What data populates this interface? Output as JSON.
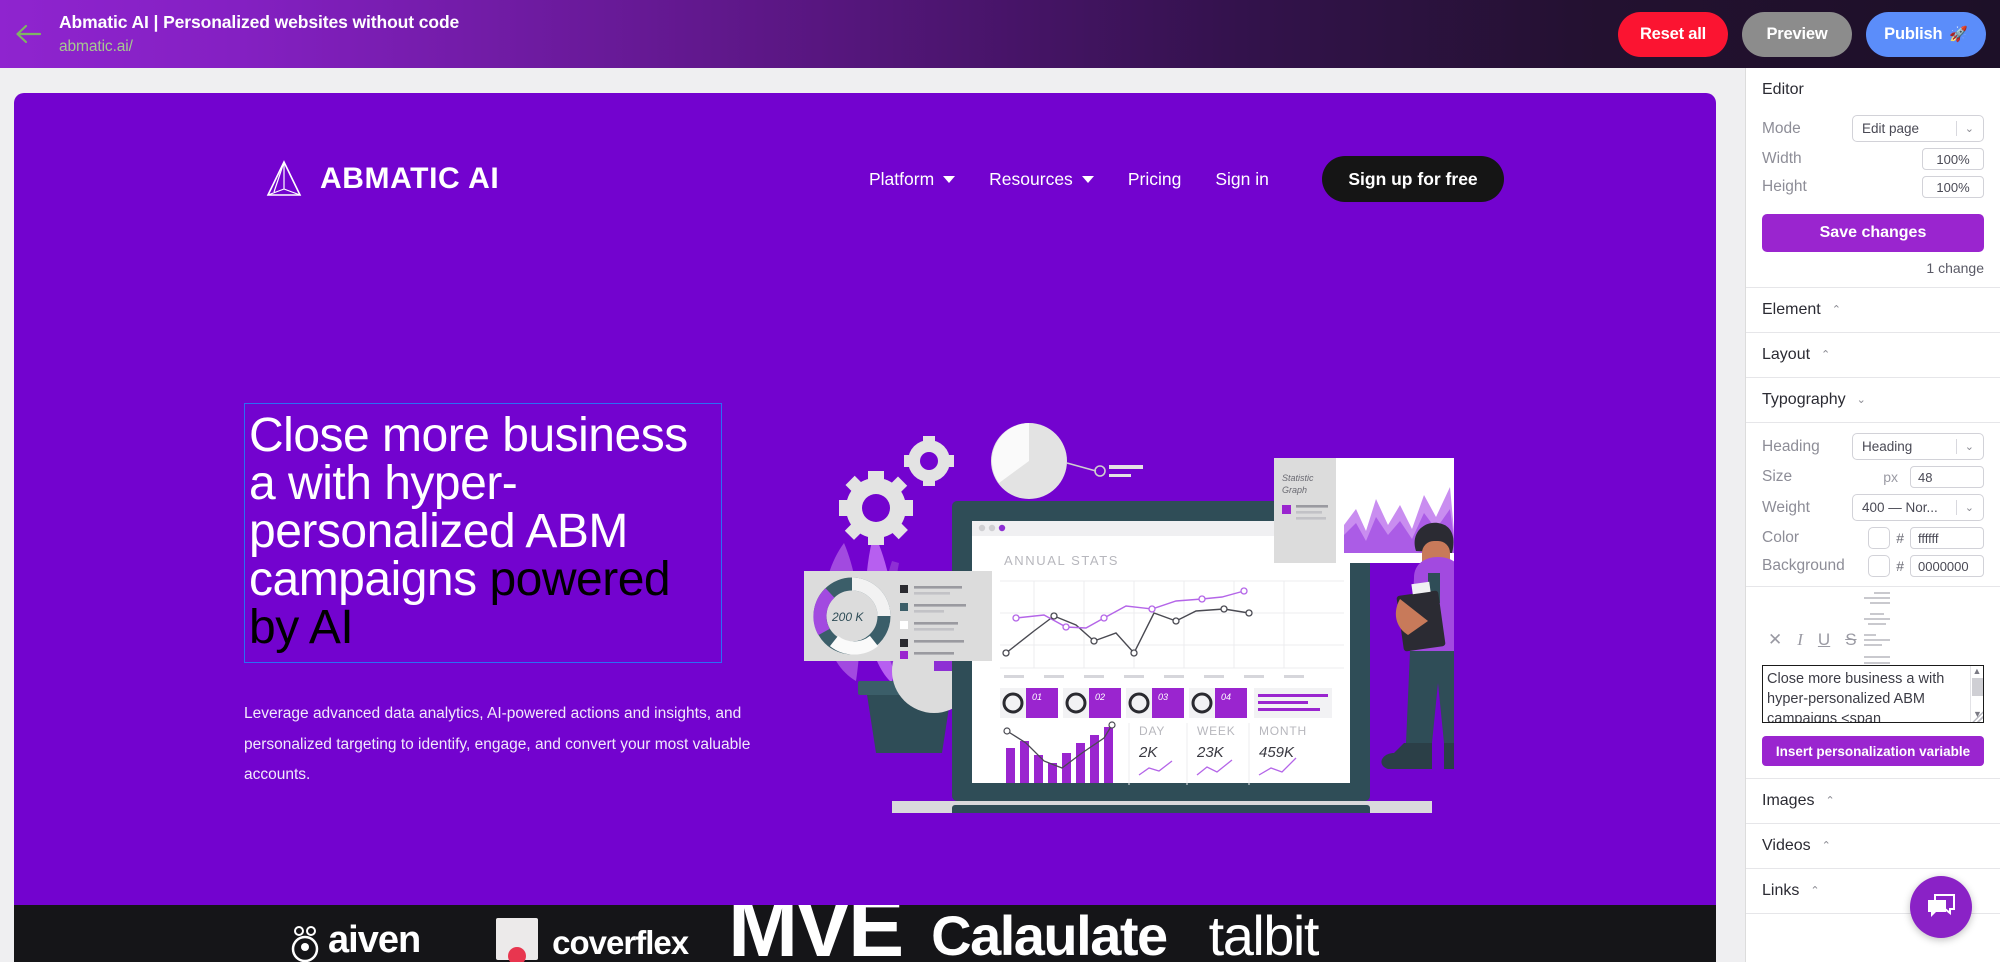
{
  "topbar": {
    "back_icon": "arrow-left-icon",
    "site_title": "Abmatic AI | Personalized websites without code",
    "site_url": "abmatic.ai/",
    "buttons": {
      "reset": "Reset all",
      "preview": "Preview",
      "publish": "Publish",
      "publish_icon": "rocket-icon"
    },
    "colors": {
      "reset_bg": "#fb1431",
      "preview_bg": "#8c8c8c",
      "publish_bg": "#5b8dfa",
      "url_text": "#a6c98f"
    }
  },
  "preview": {
    "background": "#7303cf",
    "nav": {
      "brand": "ABMATIC AI",
      "brand_icon": "triangle-logo-icon",
      "links": [
        {
          "label": "Platform",
          "has_caret": true
        },
        {
          "label": "Resources",
          "has_caret": true
        },
        {
          "label": "Pricing",
          "has_caret": false
        },
        {
          "label": "Sign in",
          "has_caret": false
        }
      ],
      "cta": "Sign up for free"
    },
    "hero": {
      "headline_white": "Close more business a with hyper-personalized ABM campaigns ",
      "headline_accent": "powered by AI",
      "headline_accent_color": "#000000",
      "selection_border_color": "#2b6ef5",
      "subcopy": "Leverage advanced data analytics, AI-powered actions and insights, and personalized targeting to identify, engage, and convert your most valuable accounts."
    },
    "illustration": {
      "name": "analytics-dashboard-illustration",
      "screen_title": "ANNUAL STATS",
      "donut_label": "200 K",
      "card_title": "Statistic Graph",
      "kpis": [
        {
          "label": "DAY",
          "value": "2K"
        },
        {
          "label": "WEEK",
          "value": "23K"
        },
        {
          "label": "MONTH",
          "value": "459K"
        }
      ],
      "tiles": [
        "01",
        "02",
        "03",
        "04"
      ]
    },
    "logos": [
      "aiven",
      "coverflex",
      "MVE",
      "Calaulate",
      "talbit"
    ]
  },
  "sidebar": {
    "editor": {
      "title": "Editor",
      "mode_label": "Mode",
      "mode_value": "Edit page",
      "width_label": "Width",
      "width_value": "100%",
      "height_label": "Height",
      "height_value": "100%",
      "save_label": "Save changes",
      "change_count": "1 change"
    },
    "sections": [
      {
        "title": "Element",
        "chev": "⌃"
      },
      {
        "title": "Layout",
        "chev": "⌃"
      },
      {
        "title": "Typography",
        "chev": "⌄"
      }
    ],
    "typography": {
      "heading_label": "Heading",
      "heading_value": "Heading",
      "size_label": "Size",
      "size_unit": "px",
      "size_value": "48",
      "weight_label": "Weight",
      "weight_value": "400 — Nor...",
      "color_label": "Color",
      "color_hash": "#",
      "color_value": "ffffff",
      "background_label": "Background",
      "background_hash": "#",
      "background_value": "0000000"
    },
    "richtext": {
      "clear_icon": "clear-format-icon",
      "italic_icon": "italic-icon",
      "underline_icon": "underline-icon",
      "strikethrough_icon": "strikethrough-icon",
      "align_icons": [
        "align-right-icon",
        "align-center-icon",
        "align-left-icon",
        "align-justify-icon"
      ],
      "content": "Close more business a with hyper-personalized ABM campaigns <span",
      "insert_var_label": "Insert personalization variable",
      "scroll_up_icon": "▲",
      "scroll_down_icon": "▼"
    },
    "bottom_sections": [
      {
        "title": "Images",
        "chev": "⌃"
      },
      {
        "title": "Videos",
        "chev": "⌃"
      },
      {
        "title": "Links",
        "chev": "⌃"
      }
    ],
    "chat_icon": "chat-bubbles-icon"
  }
}
